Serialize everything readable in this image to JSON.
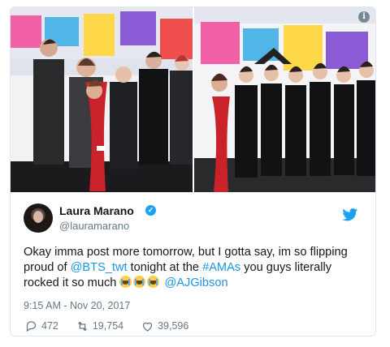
{
  "tweet": {
    "author_name": "Laura Marano",
    "handle": "@lauramarano",
    "text_parts": [
      "Okay imma post more tomorrow, but I gotta say, im so flipping proud of ",
      "@BTS_twt",
      " tonight at the ",
      "#AMAs",
      " you guys literally rocked it so much ",
      "@AJGibson"
    ],
    "timestamp": "9:15 AM - Nov 20, 2017",
    "replies": "472",
    "retweets": "19,754",
    "likes": "39,596",
    "emoji": [
      "crying-face-emoji",
      "crying-face-emoji",
      "crying-face-emoji"
    ]
  },
  "colors": {
    "link": "#1b95e0",
    "verified": "#1da1f2",
    "muted": "#657786",
    "border": "#e1e8ed"
  },
  "icons": {
    "info": "info-icon",
    "verified": "verified-badge-icon",
    "bird": "twitter-bird-icon",
    "reply": "reply-icon",
    "retweet": "retweet-icon",
    "like": "heart-icon"
  }
}
